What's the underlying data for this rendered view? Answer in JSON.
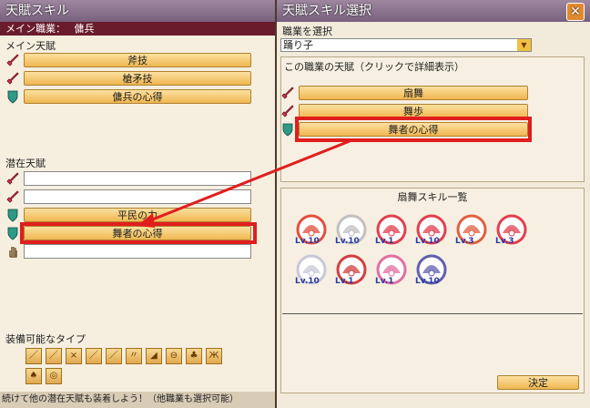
{
  "left_window": {
    "title": "天賦スキル",
    "main_job_label": "メイン職業：",
    "main_job_value": "傭兵",
    "main_talent_label": "メイン天賦",
    "main_talents": [
      "斧技",
      "槍矛技",
      "傭兵の心得"
    ],
    "latent_label": "潜在天賦",
    "latent_slots": [
      "",
      "",
      "平民の力",
      "舞者の心得",
      ""
    ],
    "equip_label": "装備可能なタイプ",
    "footer_text": "続けて他の潜在天賦も装着しよう！（他職業も選択可能）"
  },
  "right_window": {
    "title": "天賦スキル選択",
    "job_select_label": "職業を選択",
    "job_selected": "踊り子",
    "job_talent_label": "この職業の天賦（クリックで詳細表示）",
    "job_talents": [
      "扇舞",
      "舞歩",
      "舞者の心得"
    ],
    "skill_list_title": "扇舞スキル一覧",
    "skill_levels": [
      "Lv.10",
      "Lv.10",
      "Lv.1",
      "Lv.10",
      "Lv.3",
      "Lv.3",
      "Lv.10",
      "Lv.1",
      "Lv.1",
      "Lv.10"
    ],
    "confirm_label": "決定"
  },
  "icons": {
    "close": "close-icon",
    "sword": "sword-icon",
    "shield": "shield-icon",
    "hand": "hand-icon"
  },
  "colors": {
    "highlight": "#e01e1e",
    "button": "#f0b650",
    "title": "#77617c"
  }
}
